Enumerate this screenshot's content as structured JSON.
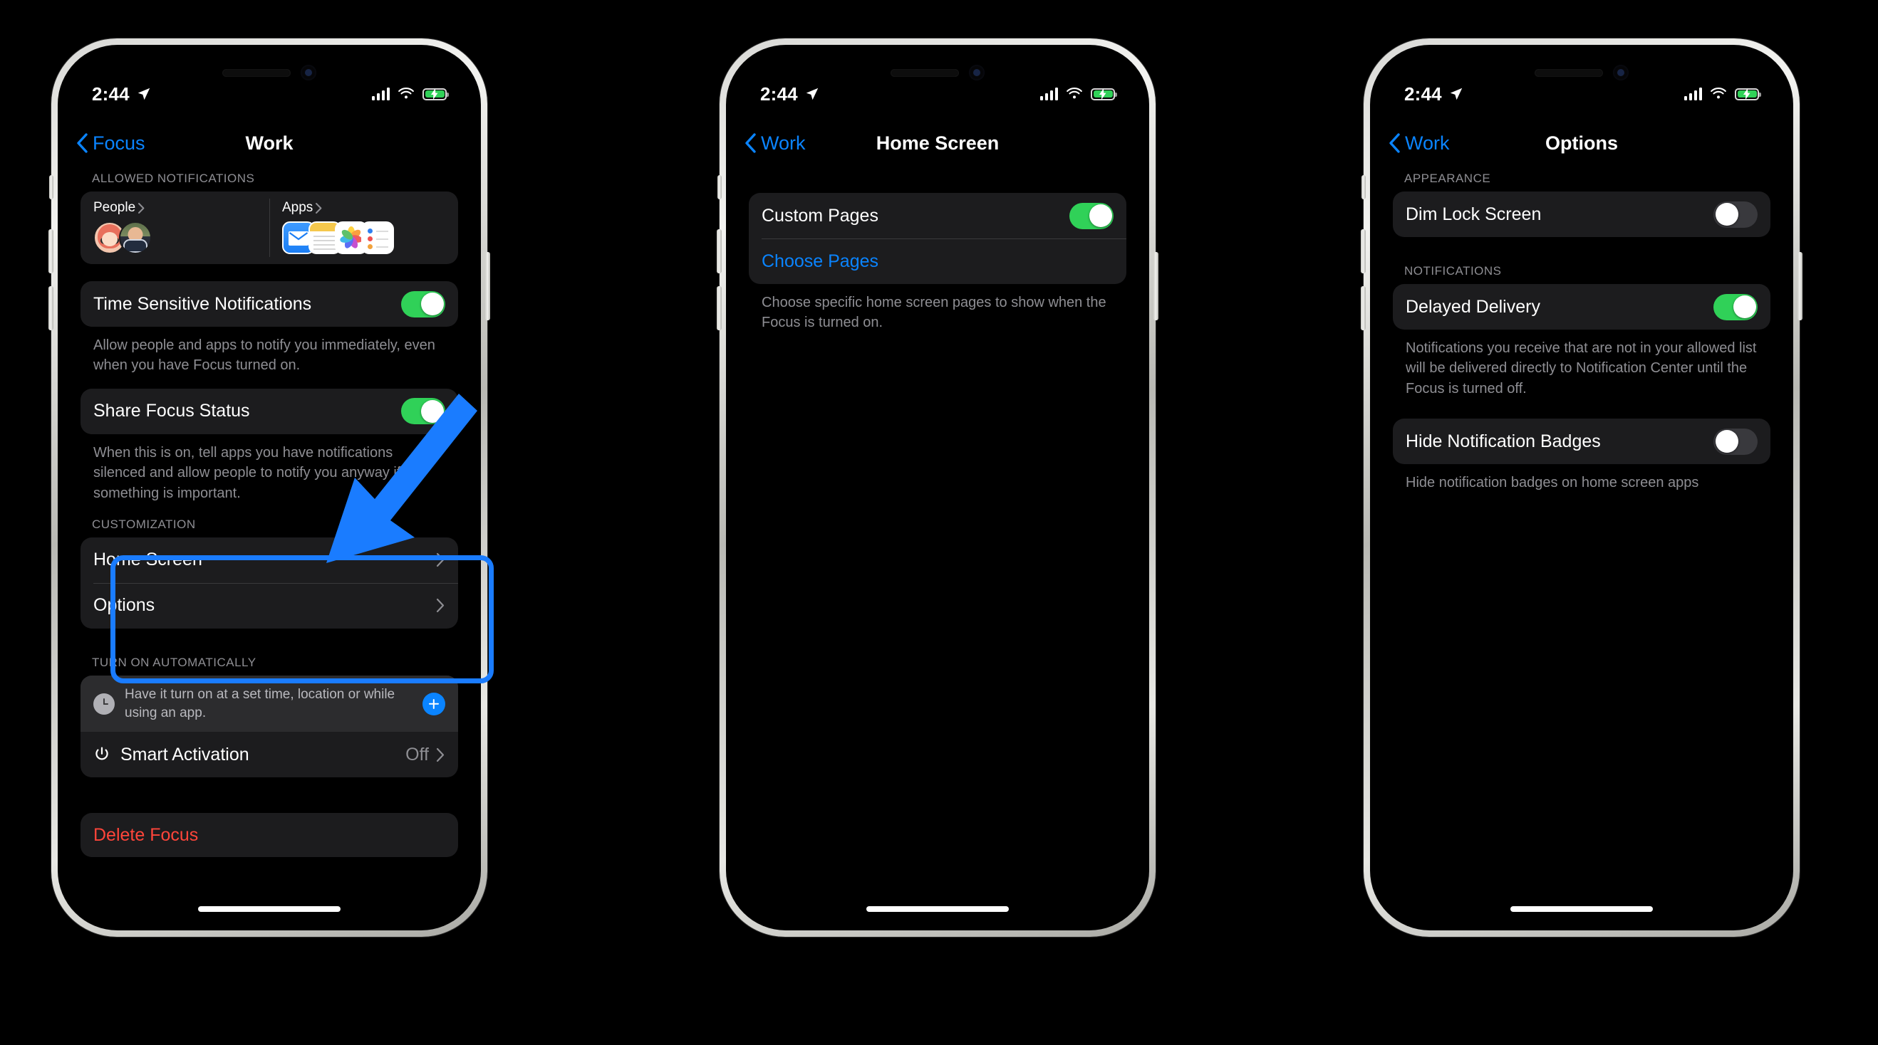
{
  "meta": {
    "accent_blue": "#0a84ff",
    "toggle_on_green": "#30d158",
    "destructive_red": "#ff453a",
    "annotation_blue": "#1a7cff",
    "card_bg": "#1c1c1e"
  },
  "status_bar": {
    "time": "2:44",
    "location_icon": "location-arrow-icon",
    "cellular_icon": "cellular-bars-icon",
    "wifi_icon": "wifi-icon",
    "battery_icon": "battery-charging-icon"
  },
  "phones": [
    {
      "id": "phone-work",
      "nav": {
        "back_label": "Focus",
        "title": "Work"
      },
      "sections": [
        {
          "header": "ALLOWED NOTIFICATIONS"
        }
      ],
      "allowed": {
        "people": {
          "label": "People",
          "chevron": "chevron-right-icon"
        },
        "apps": {
          "label": "Apps",
          "chevron": "chevron-right-icon",
          "icons": [
            "mail-app-icon",
            "notes-app-icon",
            "photos-app-icon",
            "reminders-app-icon"
          ]
        }
      },
      "time_sensitive": {
        "label": "Time Sensitive Notifications",
        "toggle": "on",
        "footnote": "Allow people and apps to notify you immediately, even when you have Focus turned on."
      },
      "share_focus": {
        "label": "Share Focus Status",
        "toggle": "on",
        "footnote": "When this is on, tell apps you have notifications silenced and allow people to notify you anyway if something is important."
      },
      "customization": {
        "header": "CUSTOMIZATION",
        "rows": [
          {
            "label": "Home Screen",
            "chevron": "chevron-right-icon"
          },
          {
            "label": "Options",
            "chevron": "chevron-right-icon"
          }
        ],
        "highlighted": true
      },
      "turn_on_automatically": {
        "header": "TURN ON AUTOMATICALLY",
        "suggestion": "Have it turn on at a set time, location or while using an app.",
        "add_button": "plus-icon",
        "clock_icon": "clock-icon",
        "smart_activation": {
          "icon": "power-icon",
          "label": "Smart Activation",
          "value": "Off",
          "chevron": "chevron-right-icon"
        }
      },
      "delete": {
        "label": "Delete Focus"
      }
    },
    {
      "id": "phone-home-screen",
      "nav": {
        "back_label": "Work",
        "title": "Home Screen"
      },
      "rows": [
        {
          "label": "Custom Pages",
          "type": "toggle",
          "toggle": "on"
        },
        {
          "label": "Choose Pages",
          "type": "link"
        }
      ],
      "footnote": "Choose specific home screen pages to show when the Focus is turned on."
    },
    {
      "id": "phone-options",
      "nav": {
        "back_label": "Work",
        "title": "Options"
      },
      "groups": [
        {
          "header": "APPEARANCE",
          "rows": [
            {
              "label": "Dim Lock Screen",
              "toggle": "off"
            }
          ],
          "footnote": ""
        },
        {
          "header": "NOTIFICATIONS",
          "rows": [
            {
              "label": "Delayed Delivery",
              "toggle": "on"
            }
          ],
          "footnote": "Notifications you receive that are not in your allowed list will be delivered directly to Notification Center until the Focus is turned off."
        },
        {
          "header": "",
          "rows": [
            {
              "label": "Hide Notification Badges",
              "toggle": "off"
            }
          ],
          "footnote": "Hide notification badges on home screen apps"
        }
      ]
    }
  ]
}
